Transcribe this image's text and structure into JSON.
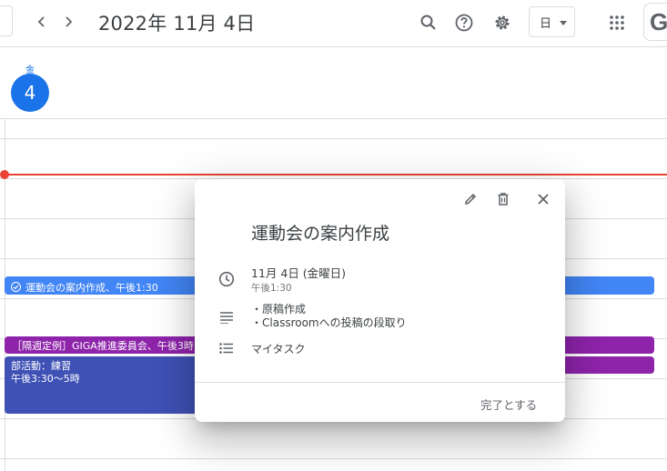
{
  "header": {
    "prev_symbol": "‹",
    "next_symbol": "›",
    "date_title": "2022年 11月 4日",
    "view_label": "日",
    "account_letter": "G"
  },
  "day": {
    "weekday": "金",
    "date_number": "4"
  },
  "events": {
    "task": {
      "label": "運動会の案内作成、午後1:30"
    },
    "meeting": {
      "label": "［隔週定例］GIGA推進委員会、午後3時"
    },
    "club": {
      "title": "部活動：練習",
      "time": "午後3:30〜5時"
    }
  },
  "popover": {
    "title": "運動会の案内作成",
    "date": "11月 4日 (金曜日)",
    "time": "午後1:30",
    "description_lines": [
      "・原稿作成",
      "・Classroomへの投稿の段取り"
    ],
    "list_name": "マイタスク",
    "complete_label": "完了とする"
  },
  "colors": {
    "accent": "#1a73e8",
    "now_line": "#ea4335",
    "task_event": "#4285f4",
    "meeting_event": "#8e24aa",
    "club_event": "#3f51b5"
  },
  "icons": [
    "chevron-left-icon",
    "chevron-right-icon",
    "search-icon",
    "help-icon",
    "gear-icon",
    "apps-grid-icon",
    "pencil-icon",
    "trash-icon",
    "close-icon",
    "clock-icon",
    "description-icon",
    "list-icon",
    "check-circle-icon"
  ]
}
